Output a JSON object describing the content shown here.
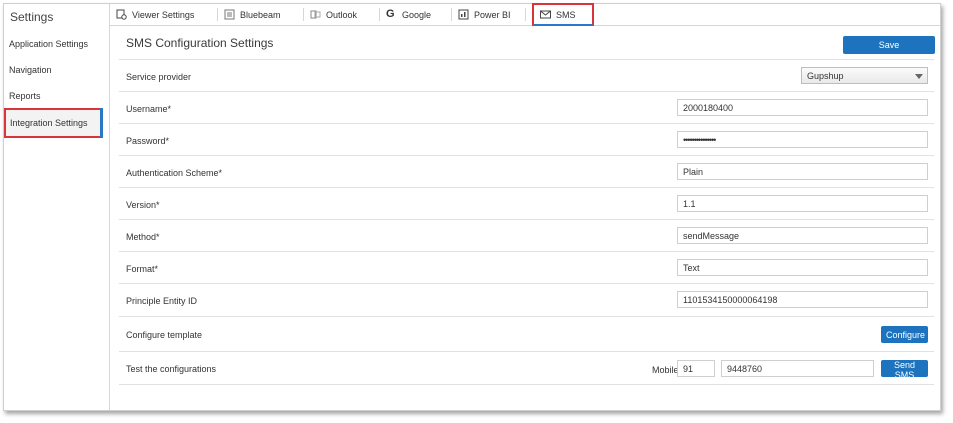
{
  "sidebar": {
    "title": "Settings",
    "items": [
      {
        "label": "Application Settings"
      },
      {
        "label": "Navigation"
      },
      {
        "label": "Reports"
      },
      {
        "label": "Integration Settings"
      }
    ]
  },
  "tabs": [
    {
      "label": "Viewer Settings",
      "icon": "viewer-settings-icon"
    },
    {
      "label": "Bluebeam",
      "icon": "bluebeam-icon"
    },
    {
      "label": "Outlook",
      "icon": "outlook-icon"
    },
    {
      "label": "Google",
      "icon": "google-icon"
    },
    {
      "label": "Power BI",
      "icon": "power-bi-icon"
    },
    {
      "label": "SMS",
      "icon": "envelope-icon"
    }
  ],
  "page": {
    "title": "SMS Configuration Settings",
    "save_label": "Save"
  },
  "form": {
    "service_provider": {
      "label": "Service provider",
      "value": "Gupshup"
    },
    "username": {
      "label": "Username*",
      "value": "2000180400"
    },
    "password": {
      "label": "Password*",
      "value": "•••••••••••••••"
    },
    "auth_scheme": {
      "label": "Authentication Scheme*",
      "value": "Plain"
    },
    "version": {
      "label": "Version*",
      "value": "1.1"
    },
    "method": {
      "label": "Method*",
      "value": "sendMessage"
    },
    "format": {
      "label": "Format*",
      "value": "Text"
    },
    "entity_id": {
      "label": "Principle Entity ID",
      "value": "1101534150000064198"
    },
    "template": {
      "label": "Configure template",
      "button": "Configure"
    },
    "test": {
      "label": "Test the configurations",
      "mobile_label": "Mobile",
      "country_code": "91",
      "mobile_number": "9448760",
      "button": "Send SMS"
    }
  },
  "colors": {
    "accent": "#1e73be",
    "highlight": "#d9343a"
  }
}
